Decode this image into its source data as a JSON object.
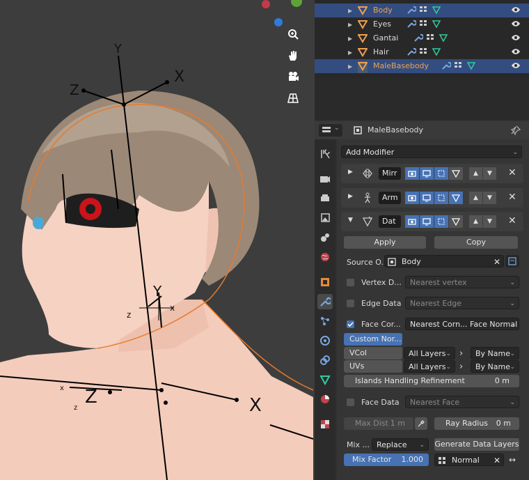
{
  "viewport": {
    "axis_labels": {
      "y_top": "Y",
      "x_top": "X",
      "z_top": "Z",
      "y_mid": "Y",
      "x_mid": "x",
      "z_mid": "z",
      "z_low": "Z",
      "x_low": "X",
      "z_small": "z",
      "x_small": "x"
    },
    "tools": [
      "zoom-icon",
      "hand-icon",
      "camera-icon",
      "grid-icon"
    ]
  },
  "outliner": {
    "rows": [
      {
        "name": "Body",
        "selected": true,
        "active_text": true
      },
      {
        "name": "Eyes",
        "selected": false
      },
      {
        "name": "Gantai",
        "selected": false
      },
      {
        "name": "Hair",
        "selected": false
      },
      {
        "name": "MaleBasebody",
        "selected": true,
        "active_text": true
      }
    ]
  },
  "properties": {
    "object_name": "MaleBasebody",
    "add_modifier": "Add Modifier",
    "modifiers": [
      {
        "name": "Mirr",
        "icon": "mirror-icon"
      },
      {
        "name": "Arm",
        "icon": "armature-icon"
      },
      {
        "name": "Dat",
        "icon": "data-transfer-icon"
      }
    ],
    "apply_label": "Apply",
    "copy_label": "Copy",
    "source_label": "Source O...",
    "source_value": "Body",
    "vertex_data": {
      "label": "Vertex D...",
      "value": "Nearest vertex",
      "checked": false
    },
    "edge_data": {
      "label": "Edge Data",
      "value": "Nearest Edge",
      "checked": false
    },
    "face_corner": {
      "label": "Face Cor...",
      "value": "Nearest Corn... Face Normal",
      "checked": true
    },
    "custom_normals": "Custom Nor...",
    "vcol": {
      "label": "VCol",
      "from": "All Layers",
      "to": "By Name"
    },
    "uvs": {
      "label": "UVs",
      "from": "All Layers",
      "to": "By Name"
    },
    "islands": {
      "label": "Islands Handling Refinement",
      "value": "0 m"
    },
    "face_data": {
      "label": "Face Data",
      "value": "Nearest Face",
      "checked": false
    },
    "max_dist": {
      "label": "Max Dist",
      "value": "1 m"
    },
    "ray_radius": {
      "label": "Ray Radius",
      "value": "0 m"
    },
    "mix_mode_label": "Mix ...",
    "mix_mode_value": "Replace",
    "generate_label": "Generate Data Layers",
    "mix_factor": {
      "label": "Mix Factor",
      "value": "1.000"
    },
    "vgroup": "Normal",
    "colors": {
      "accent": "#4772b3",
      "selection": "#334d80",
      "orange": "#f0a050",
      "mesh_green": "#2fcca0"
    }
  }
}
